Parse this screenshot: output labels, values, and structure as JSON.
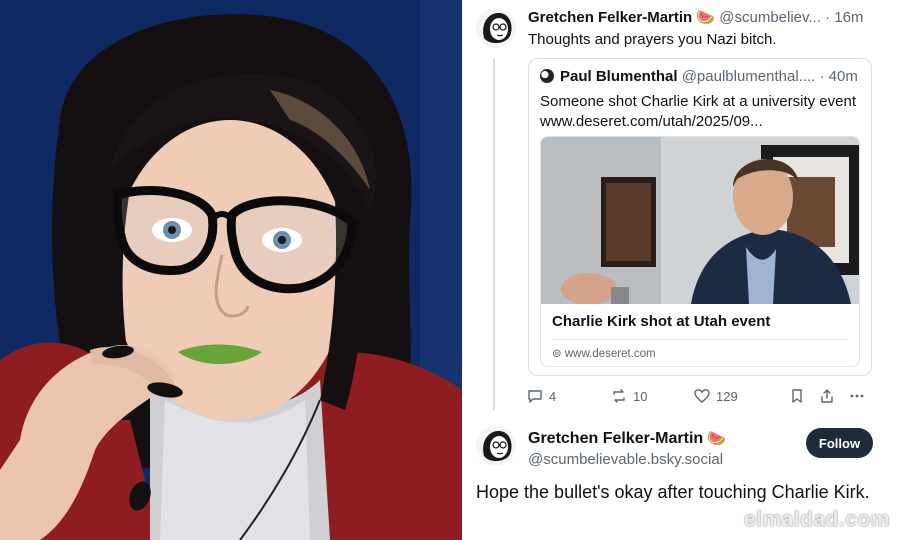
{
  "left_photo": {
    "description_icon": "portrait-photo"
  },
  "post1": {
    "author_name": "Gretchen Felker-Martin",
    "emoji": "🍉",
    "handle": "@scumbeliev...",
    "time": "· 16m",
    "text": "Thoughts and prayers you Nazi bitch."
  },
  "quote": {
    "author_name": "Paul Blumenthal",
    "handle": "@paulblumenthal....",
    "time": "· 40m",
    "text": "Someone shot Charlie Kirk at a university event www.deseret.com/utah/2025/09...",
    "card": {
      "title": "Charlie Kirk shot at Utah event",
      "url": "www.deseret.com"
    }
  },
  "actions": {
    "replies": "4",
    "reposts": "10",
    "likes": "129"
  },
  "post2": {
    "author_name": "Gretchen Felker-Martin",
    "emoji": "🍉",
    "handle": "@scumbelievable.bsky.social",
    "follow_label": "Follow",
    "text": "Hope the bullet's okay after touching Charlie Kirk."
  },
  "watermark": "elmaldad.com",
  "colors": {
    "follow_button": "#1e2a38",
    "muted_text": "#5b6670",
    "photo_background": "#0f2a63"
  }
}
